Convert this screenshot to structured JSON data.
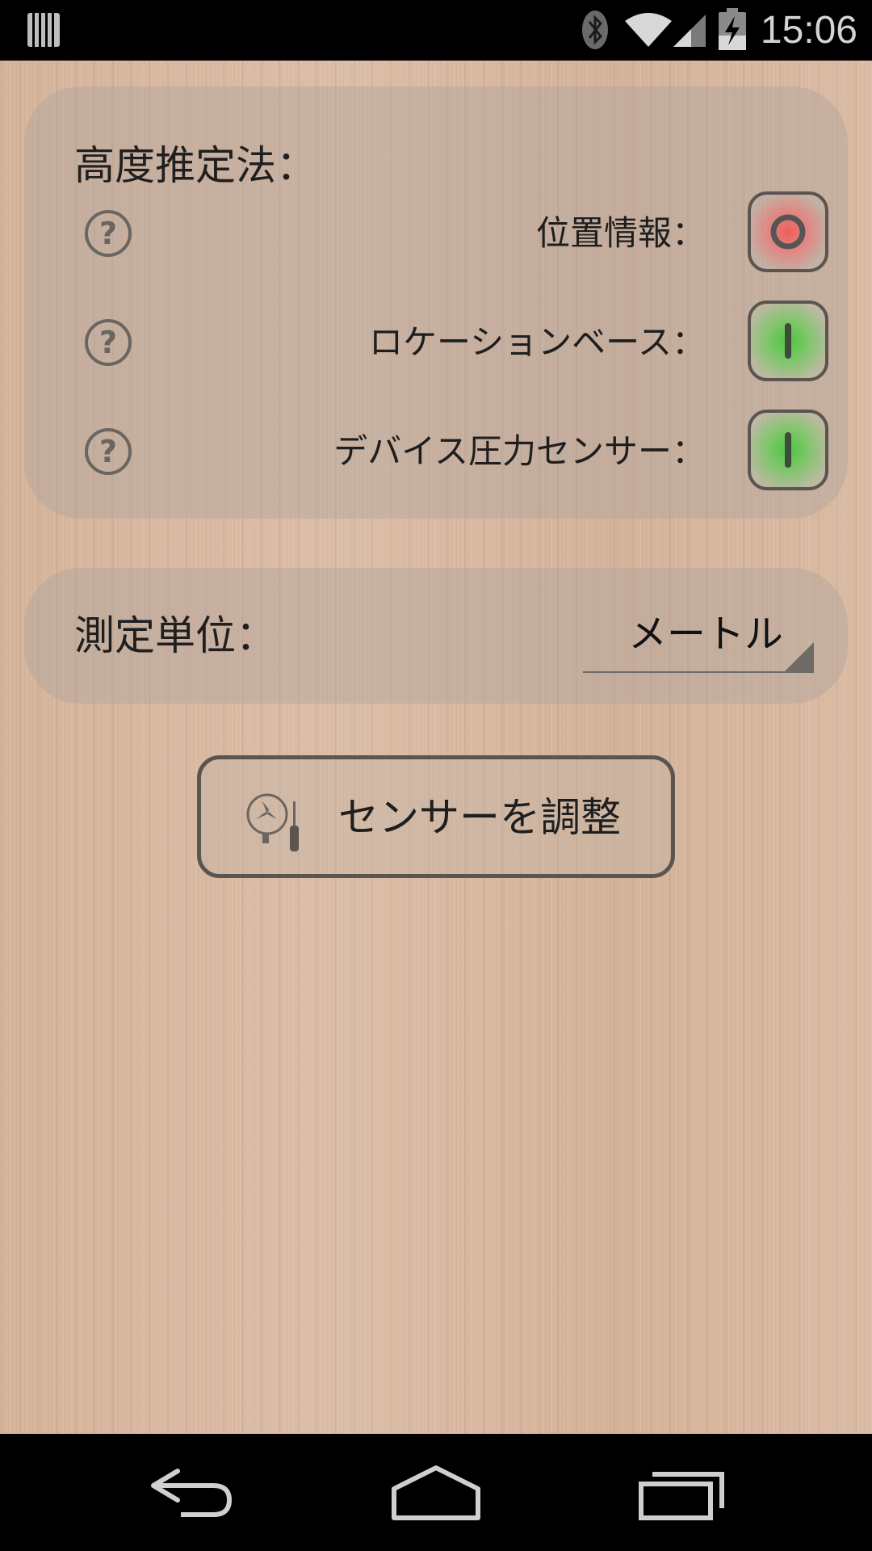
{
  "status_bar": {
    "time": "15:06",
    "icons": [
      "barcode-icon",
      "bluetooth-icon",
      "wifi-icon",
      "signal-icon",
      "battery-charging-icon"
    ]
  },
  "methods_panel": {
    "title": "高度推定法：",
    "rows": [
      {
        "label": "位置情報：",
        "state": "off",
        "help_icon": "question-circle-icon"
      },
      {
        "label": "ロケーションベース：",
        "state": "on",
        "help_icon": "question-circle-icon"
      },
      {
        "label": "デバイス圧力センサー：",
        "state": "on",
        "help_icon": "question-circle-icon"
      }
    ]
  },
  "units_panel": {
    "title": "測定単位：",
    "selected_unit": "メートル"
  },
  "calibrate_button": {
    "label": "センサーを調整",
    "icon": "gauge-screwdriver-icon"
  },
  "navigation": {
    "icons": [
      "back-icon",
      "home-icon",
      "recent-apps-icon"
    ]
  },
  "colors": {
    "toggle_off": "#e85a5a",
    "toggle_on": "#5ac84a",
    "border": "#5a5550"
  }
}
